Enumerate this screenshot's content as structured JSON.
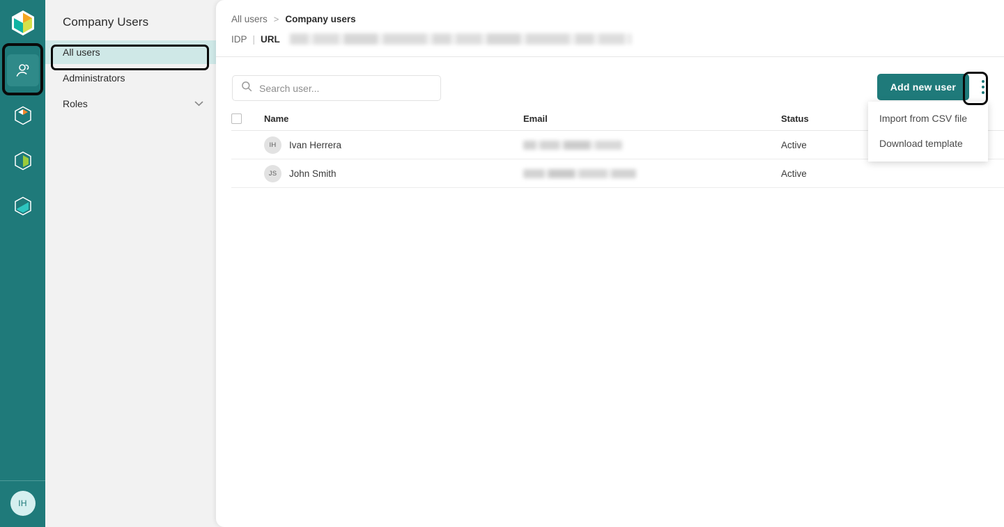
{
  "theme": {
    "brand_teal": "#1f7a7a",
    "nav_selected_bg": "#cfe8e7",
    "panel_bg": "#f2f2f2",
    "avatar_bg": "#e2e2e2",
    "rail_avatar_bg": "#d5efef"
  },
  "rail": {
    "logo_name": "cube-logo-icon",
    "items": [
      {
        "icon": "users-icon",
        "name": "rail-item-users",
        "active": true
      },
      {
        "icon": "cube-orange-icon",
        "name": "rail-item-catalog",
        "active": false
      },
      {
        "icon": "cube-green-icon",
        "name": "rail-item-analytics",
        "active": false
      },
      {
        "icon": "cube-cyan-icon",
        "name": "rail-item-settings",
        "active": false
      }
    ],
    "avatar_initials": "IH"
  },
  "nav": {
    "title": "Company Users",
    "items": [
      {
        "label": "All users",
        "selected": true,
        "chevron": false
      },
      {
        "label": "Administrators",
        "selected": false,
        "chevron": false
      },
      {
        "label": "Roles",
        "selected": false,
        "chevron": true
      }
    ]
  },
  "breadcrumb": {
    "parent": "All users",
    "separator": ">",
    "current": "Company users"
  },
  "idp": {
    "label": "IDP",
    "pipe": "|",
    "url_label": "URL",
    "url_value": ""
  },
  "toolbar": {
    "search_placeholder": "Search user...",
    "search_value": "",
    "search_icon": "search-icon",
    "add_user_label": "Add new user",
    "kebab_icon": "more-vertical-icon"
  },
  "menu": {
    "items": [
      {
        "label": "Import from CSV file"
      },
      {
        "label": "Download template"
      }
    ]
  },
  "table": {
    "columns": [
      "Name",
      "Email",
      "Status"
    ],
    "rows": [
      {
        "initials": "IH",
        "name": "Ivan Herrera",
        "email": "",
        "status": "Active"
      },
      {
        "initials": "JS",
        "name": "John Smith",
        "email": "",
        "status": "Active"
      }
    ]
  }
}
